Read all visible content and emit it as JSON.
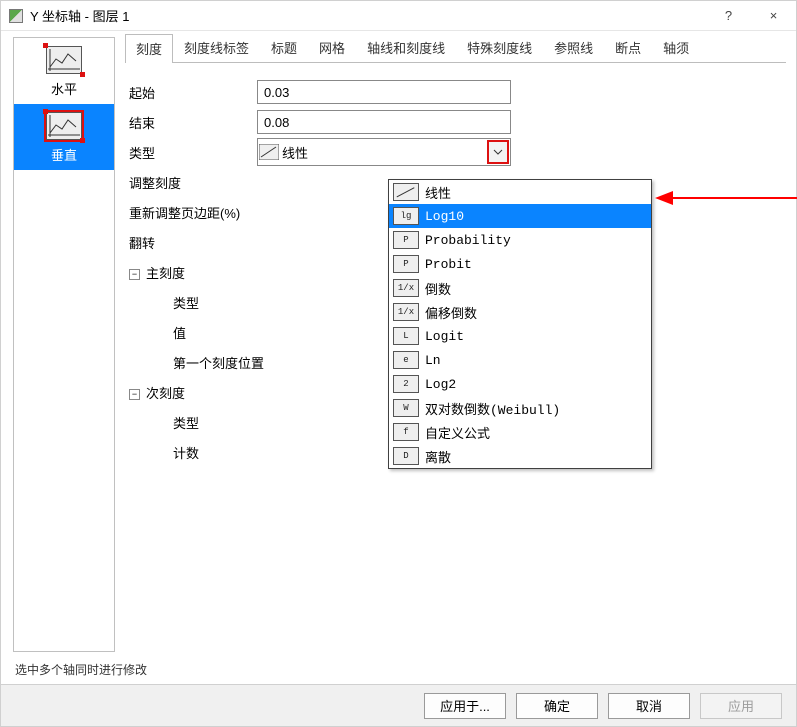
{
  "window": {
    "title": "Y 坐标轴 - 图层 1",
    "help_glyph": "?",
    "close_glyph": "×"
  },
  "axis_list": {
    "items": [
      {
        "label": "水平"
      },
      {
        "label": "垂直"
      }
    ],
    "selected_index": 1
  },
  "tabs": {
    "items": [
      "刻度",
      "刻度线标签",
      "标题",
      "网格",
      "轴线和刻度线",
      "特殊刻度线",
      "参照线",
      "断点",
      "轴须"
    ],
    "active_index": 0
  },
  "form": {
    "start_label": "起始",
    "start_value": "0.03",
    "end_label": "结束",
    "end_value": "0.08",
    "type_label": "类型",
    "type_selected": "线性",
    "adjust_label": "调整刻度",
    "margin_label": "重新调整页边距(%)",
    "flip_label": "翻转",
    "major_group": "主刻度",
    "minor_group": "次刻度",
    "sub_type_label": "类型",
    "value_label": "值",
    "first_tick_label": "第一个刻度位置",
    "count_label": "计数"
  },
  "dropdown": {
    "highlight_index": 1,
    "options": [
      {
        "label": "线性",
        "glyph": "/"
      },
      {
        "label": "Log10",
        "glyph": "lg"
      },
      {
        "label": "Probability",
        "glyph": "P"
      },
      {
        "label": "Probit",
        "glyph": "P"
      },
      {
        "label": "倒数",
        "glyph": "1/x"
      },
      {
        "label": "偏移倒数",
        "glyph": "1/x"
      },
      {
        "label": "Logit",
        "glyph": "L"
      },
      {
        "label": "Ln",
        "glyph": "e"
      },
      {
        "label": "Log2",
        "glyph": "2"
      },
      {
        "label": "双对数倒数(Weibull)",
        "glyph": "W"
      },
      {
        "label": "自定义公式",
        "glyph": "f"
      },
      {
        "label": "离散",
        "glyph": "D"
      }
    ]
  },
  "footer": {
    "hint": "选中多个轴同时进行修改",
    "apply_to": "应用于...",
    "ok": "确定",
    "cancel": "取消",
    "apply": "应用"
  }
}
